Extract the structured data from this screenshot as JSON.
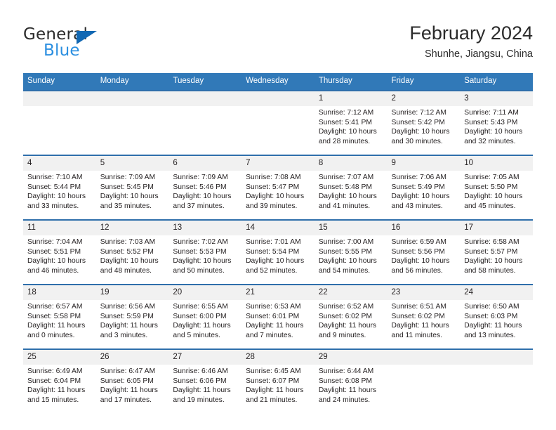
{
  "brand": {
    "name_top": "General",
    "name_bottom": "Blue",
    "triangle_icon": "blue-triangle-logo-mark"
  },
  "header": {
    "title": "February 2024",
    "subtitle": "Shunhe, Jiangsu, China"
  },
  "colors": {
    "header_blue": "#3179b8",
    "row_rule_blue": "#2f6fab",
    "daynum_band": "#f1f1f1",
    "brand_blue": "#2b8fe0",
    "triangle_blue": "#1268b3",
    "text": "#231f20"
  },
  "calendar": {
    "weekday_headers": [
      "Sunday",
      "Monday",
      "Tuesday",
      "Wednesday",
      "Thursday",
      "Friday",
      "Saturday"
    ],
    "weeks": [
      [
        {
          "day": "",
          "blank": true
        },
        {
          "day": "",
          "blank": true
        },
        {
          "day": "",
          "blank": true
        },
        {
          "day": "",
          "blank": true
        },
        {
          "day": "1",
          "sunrise": "Sunrise: 7:12 AM",
          "sunset": "Sunset: 5:41 PM",
          "daylight_1": "Daylight: 10 hours",
          "daylight_2": "and 28 minutes."
        },
        {
          "day": "2",
          "sunrise": "Sunrise: 7:12 AM",
          "sunset": "Sunset: 5:42 PM",
          "daylight_1": "Daylight: 10 hours",
          "daylight_2": "and 30 minutes."
        },
        {
          "day": "3",
          "sunrise": "Sunrise: 7:11 AM",
          "sunset": "Sunset: 5:43 PM",
          "daylight_1": "Daylight: 10 hours",
          "daylight_2": "and 32 minutes."
        }
      ],
      [
        {
          "day": "4",
          "sunrise": "Sunrise: 7:10 AM",
          "sunset": "Sunset: 5:44 PM",
          "daylight_1": "Daylight: 10 hours",
          "daylight_2": "and 33 minutes."
        },
        {
          "day": "5",
          "sunrise": "Sunrise: 7:09 AM",
          "sunset": "Sunset: 5:45 PM",
          "daylight_1": "Daylight: 10 hours",
          "daylight_2": "and 35 minutes."
        },
        {
          "day": "6",
          "sunrise": "Sunrise: 7:09 AM",
          "sunset": "Sunset: 5:46 PM",
          "daylight_1": "Daylight: 10 hours",
          "daylight_2": "and 37 minutes."
        },
        {
          "day": "7",
          "sunrise": "Sunrise: 7:08 AM",
          "sunset": "Sunset: 5:47 PM",
          "daylight_1": "Daylight: 10 hours",
          "daylight_2": "and 39 minutes."
        },
        {
          "day": "8",
          "sunrise": "Sunrise: 7:07 AM",
          "sunset": "Sunset: 5:48 PM",
          "daylight_1": "Daylight: 10 hours",
          "daylight_2": "and 41 minutes."
        },
        {
          "day": "9",
          "sunrise": "Sunrise: 7:06 AM",
          "sunset": "Sunset: 5:49 PM",
          "daylight_1": "Daylight: 10 hours",
          "daylight_2": "and 43 minutes."
        },
        {
          "day": "10",
          "sunrise": "Sunrise: 7:05 AM",
          "sunset": "Sunset: 5:50 PM",
          "daylight_1": "Daylight: 10 hours",
          "daylight_2": "and 45 minutes."
        }
      ],
      [
        {
          "day": "11",
          "sunrise": "Sunrise: 7:04 AM",
          "sunset": "Sunset: 5:51 PM",
          "daylight_1": "Daylight: 10 hours",
          "daylight_2": "and 46 minutes."
        },
        {
          "day": "12",
          "sunrise": "Sunrise: 7:03 AM",
          "sunset": "Sunset: 5:52 PM",
          "daylight_1": "Daylight: 10 hours",
          "daylight_2": "and 48 minutes."
        },
        {
          "day": "13",
          "sunrise": "Sunrise: 7:02 AM",
          "sunset": "Sunset: 5:53 PM",
          "daylight_1": "Daylight: 10 hours",
          "daylight_2": "and 50 minutes."
        },
        {
          "day": "14",
          "sunrise": "Sunrise: 7:01 AM",
          "sunset": "Sunset: 5:54 PM",
          "daylight_1": "Daylight: 10 hours",
          "daylight_2": "and 52 minutes."
        },
        {
          "day": "15",
          "sunrise": "Sunrise: 7:00 AM",
          "sunset": "Sunset: 5:55 PM",
          "daylight_1": "Daylight: 10 hours",
          "daylight_2": "and 54 minutes."
        },
        {
          "day": "16",
          "sunrise": "Sunrise: 6:59 AM",
          "sunset": "Sunset: 5:56 PM",
          "daylight_1": "Daylight: 10 hours",
          "daylight_2": "and 56 minutes."
        },
        {
          "day": "17",
          "sunrise": "Sunrise: 6:58 AM",
          "sunset": "Sunset: 5:57 PM",
          "daylight_1": "Daylight: 10 hours",
          "daylight_2": "and 58 minutes."
        }
      ],
      [
        {
          "day": "18",
          "sunrise": "Sunrise: 6:57 AM",
          "sunset": "Sunset: 5:58 PM",
          "daylight_1": "Daylight: 11 hours",
          "daylight_2": "and 0 minutes."
        },
        {
          "day": "19",
          "sunrise": "Sunrise: 6:56 AM",
          "sunset": "Sunset: 5:59 PM",
          "daylight_1": "Daylight: 11 hours",
          "daylight_2": "and 3 minutes."
        },
        {
          "day": "20",
          "sunrise": "Sunrise: 6:55 AM",
          "sunset": "Sunset: 6:00 PM",
          "daylight_1": "Daylight: 11 hours",
          "daylight_2": "and 5 minutes."
        },
        {
          "day": "21",
          "sunrise": "Sunrise: 6:53 AM",
          "sunset": "Sunset: 6:01 PM",
          "daylight_1": "Daylight: 11 hours",
          "daylight_2": "and 7 minutes."
        },
        {
          "day": "22",
          "sunrise": "Sunrise: 6:52 AM",
          "sunset": "Sunset: 6:02 PM",
          "daylight_1": "Daylight: 11 hours",
          "daylight_2": "and 9 minutes."
        },
        {
          "day": "23",
          "sunrise": "Sunrise: 6:51 AM",
          "sunset": "Sunset: 6:02 PM",
          "daylight_1": "Daylight: 11 hours",
          "daylight_2": "and 11 minutes."
        },
        {
          "day": "24",
          "sunrise": "Sunrise: 6:50 AM",
          "sunset": "Sunset: 6:03 PM",
          "daylight_1": "Daylight: 11 hours",
          "daylight_2": "and 13 minutes."
        }
      ],
      [
        {
          "day": "25",
          "sunrise": "Sunrise: 6:49 AM",
          "sunset": "Sunset: 6:04 PM",
          "daylight_1": "Daylight: 11 hours",
          "daylight_2": "and 15 minutes."
        },
        {
          "day": "26",
          "sunrise": "Sunrise: 6:47 AM",
          "sunset": "Sunset: 6:05 PM",
          "daylight_1": "Daylight: 11 hours",
          "daylight_2": "and 17 minutes."
        },
        {
          "day": "27",
          "sunrise": "Sunrise: 6:46 AM",
          "sunset": "Sunset: 6:06 PM",
          "daylight_1": "Daylight: 11 hours",
          "daylight_2": "and 19 minutes."
        },
        {
          "day": "28",
          "sunrise": "Sunrise: 6:45 AM",
          "sunset": "Sunset: 6:07 PM",
          "daylight_1": "Daylight: 11 hours",
          "daylight_2": "and 21 minutes."
        },
        {
          "day": "29",
          "sunrise": "Sunrise: 6:44 AM",
          "sunset": "Sunset: 6:08 PM",
          "daylight_1": "Daylight: 11 hours",
          "daylight_2": "and 24 minutes."
        },
        {
          "day": "",
          "blank": true
        },
        {
          "day": "",
          "blank": true
        }
      ]
    ]
  }
}
